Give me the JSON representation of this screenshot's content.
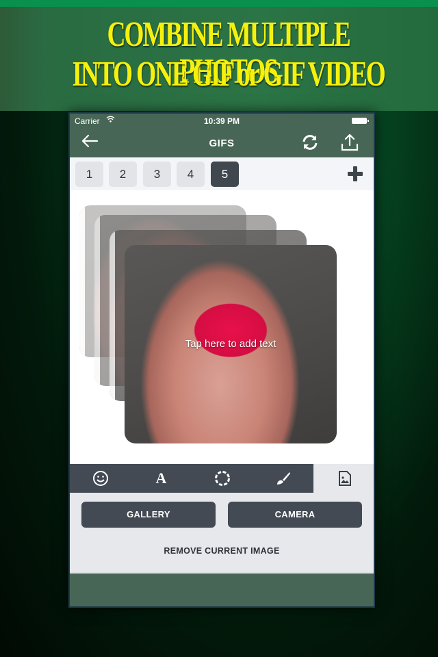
{
  "banner": {
    "line1": "COMBINE MULTIPLE PHOTOS",
    "line2": "INTO ONE GIF or GIF VIDEO",
    "text_color": "#f6f10c"
  },
  "status_bar": {
    "carrier": "Carrier",
    "wifi_icon": "wifi-icon",
    "time": "10:39 PM",
    "battery_icon": "battery-icon"
  },
  "nav": {
    "back_icon": "←",
    "title": "GIFS",
    "refresh_icon": "refresh-icon",
    "share_icon": "share-icon",
    "bar_color": "#486656"
  },
  "frames": {
    "tabs": [
      {
        "label": "1",
        "active": false
      },
      {
        "label": "2",
        "active": false
      },
      {
        "label": "3",
        "active": false
      },
      {
        "label": "4",
        "active": false
      },
      {
        "label": "5",
        "active": true
      }
    ],
    "add_icon": "plus-icon"
  },
  "canvas": {
    "overlay_text": "Tap here to add text"
  },
  "toolbar": {
    "tools": [
      {
        "name": "emoji",
        "glyph": "☺",
        "active": false
      },
      {
        "name": "text",
        "glyph": "A",
        "active": false
      },
      {
        "name": "shape",
        "glyph": "◌",
        "active": false
      },
      {
        "name": "brush",
        "glyph": "🖌",
        "active": false
      },
      {
        "name": "image",
        "glyph": "▣",
        "active": true
      }
    ]
  },
  "actions": {
    "gallery": "GALLERY",
    "camera": "CAMERA",
    "remove": "REMOVE CURRENT IMAGE"
  }
}
